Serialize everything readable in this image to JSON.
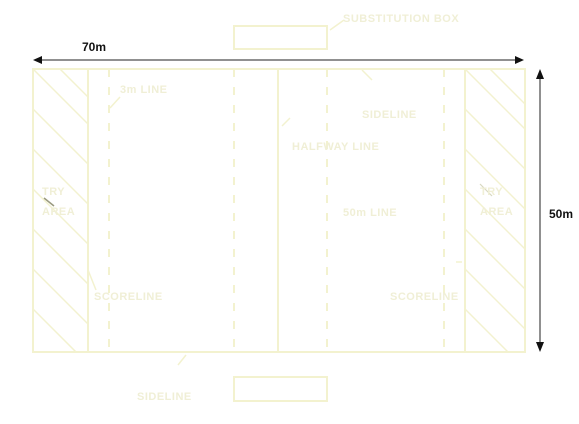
{
  "dimensions": {
    "width_label": "70m",
    "height_label": "50m"
  },
  "labels": {
    "substitution_box": "SUBSTITUTION BOX",
    "tenm_line_left": "3m LINE",
    "sideline_top": "SIDELINE",
    "halfway_line": "HALFWAY LINE",
    "try_area_left": "TRY AREA",
    "try_area_right": "TRY AREA",
    "tenm_line_right": "50m LINE",
    "scoreline_left": "SCORELINE",
    "scoreline_right": "SCORELINE",
    "sideline_bottom": "SIDELINE"
  },
  "colors": {
    "field_line": "#f3f2cf",
    "label": "#f0efd6",
    "dimension": "#111111"
  }
}
